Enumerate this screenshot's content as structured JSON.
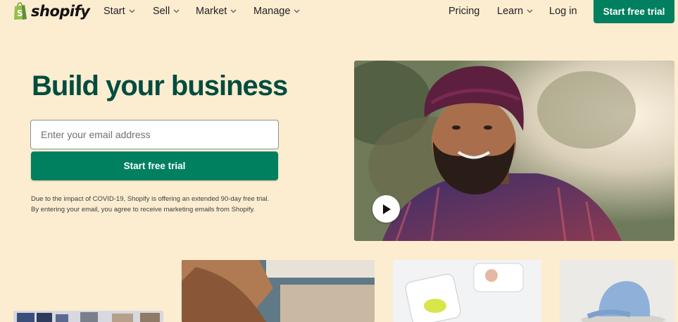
{
  "nav": {
    "brand": "shopify",
    "items": [
      {
        "label": "Start",
        "dropdown": true
      },
      {
        "label": "Sell",
        "dropdown": true
      },
      {
        "label": "Market",
        "dropdown": true
      },
      {
        "label": "Manage",
        "dropdown": true
      }
    ],
    "right_items": [
      {
        "label": "Pricing",
        "dropdown": false
      },
      {
        "label": "Learn",
        "dropdown": true
      },
      {
        "label": "Log in",
        "dropdown": false
      }
    ],
    "cta_label": "Start free trial"
  },
  "hero": {
    "title": "Build your business",
    "email_placeholder": "Enter your email address",
    "cta_label": "Start free trial",
    "disclaimer": "Due to the impact of COVID-19, Shopify is offering an extended 90-day free trial. By entering your email, you agree to receive marketing emails from Shopify."
  },
  "colors": {
    "background": "#fcecd0",
    "brand_green": "#00805f",
    "title_green": "#004c3f"
  },
  "icons": [
    "shopify-bag-icon",
    "chevron-down-icon",
    "play-icon"
  ]
}
